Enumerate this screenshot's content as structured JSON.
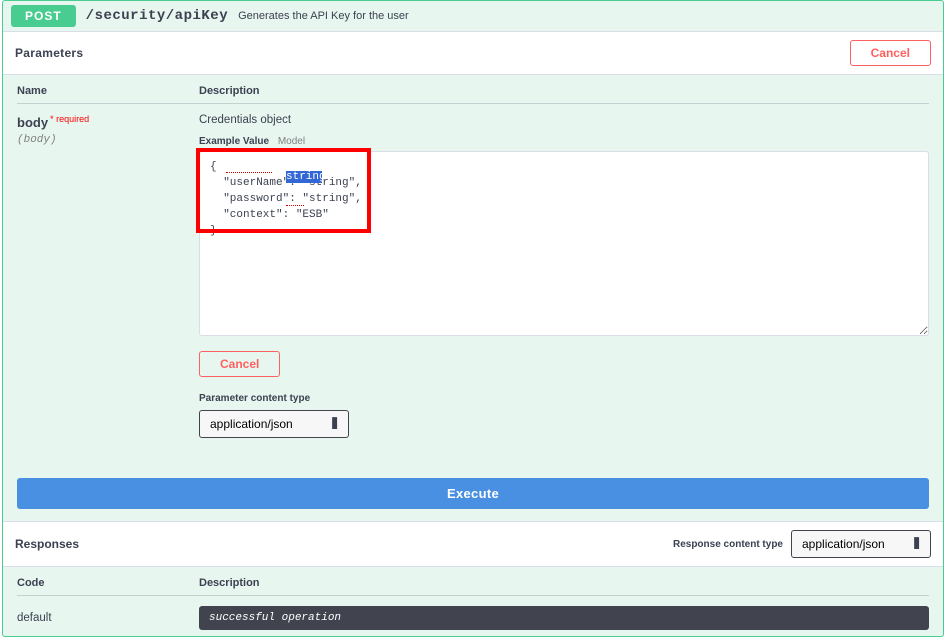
{
  "op": {
    "method": "POST",
    "path": "/security/apiKey",
    "summary": "Generates the API Key for the user"
  },
  "sections": {
    "parameters": "Parameters",
    "responses": "Responses"
  },
  "buttons": {
    "cancel_large": "Cancel",
    "cancel_small": "Cancel",
    "execute": "Execute"
  },
  "headers": {
    "name": "Name",
    "description": "Description",
    "code": "Code",
    "resp_description": "Description"
  },
  "param": {
    "name": "body",
    "required": "* required",
    "in": "(body)",
    "description": "Credentials object",
    "tab_example": "Example Value",
    "tab_model": "Model",
    "body_text": "{\n  \"userName\": \"string\",\n  \"password\": \"string\",\n  \"context\": \"ESB\"\n}",
    "highlight_overlay": "string",
    "content_type_label": "Parameter content type",
    "content_type_value": "application/json"
  },
  "responses": {
    "content_type_label": "Response content type",
    "content_type_value": "application/json",
    "default_code": "default",
    "default_desc": "successful operation"
  }
}
